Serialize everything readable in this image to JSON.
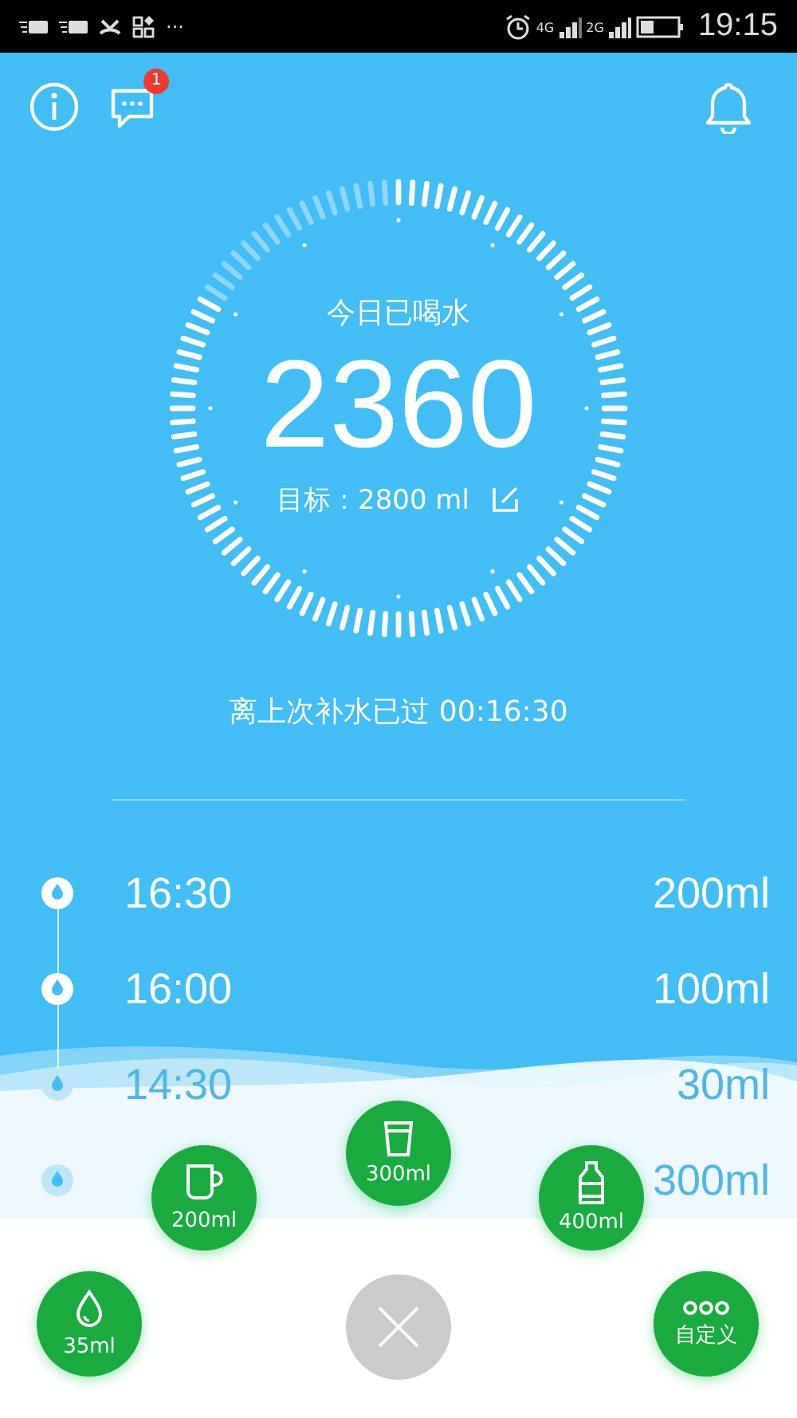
{
  "status_bar": {
    "more": "···",
    "network_1": "4G",
    "network_2": "2G",
    "time": "19:15"
  },
  "top_bar": {
    "message_badge": "1"
  },
  "today": {
    "label": "今日已喝水",
    "amount": "2360",
    "goal_label": "目标：2800 ml",
    "progress": {
      "level": 0.84
    }
  },
  "elapsed": "离上次补水已过 00:16:30",
  "log": [
    {
      "time": "16:30",
      "amount": "200ml",
      "faded": false
    },
    {
      "time": "16:00",
      "amount": "100ml",
      "faded": false
    },
    {
      "time": "14:30",
      "amount": "30ml",
      "faded": true
    },
    {
      "amount": "300ml",
      "faded": true
    }
  ],
  "quick_add": [
    {
      "kind": "cup",
      "label": "200ml"
    },
    {
      "kind": "glass",
      "label": "300ml"
    },
    {
      "kind": "bottle",
      "label": "400ml"
    },
    {
      "kind": "drop",
      "label": "35ml"
    },
    {
      "kind": "close"
    },
    {
      "kind": "custom",
      "label": "自定义"
    }
  ]
}
